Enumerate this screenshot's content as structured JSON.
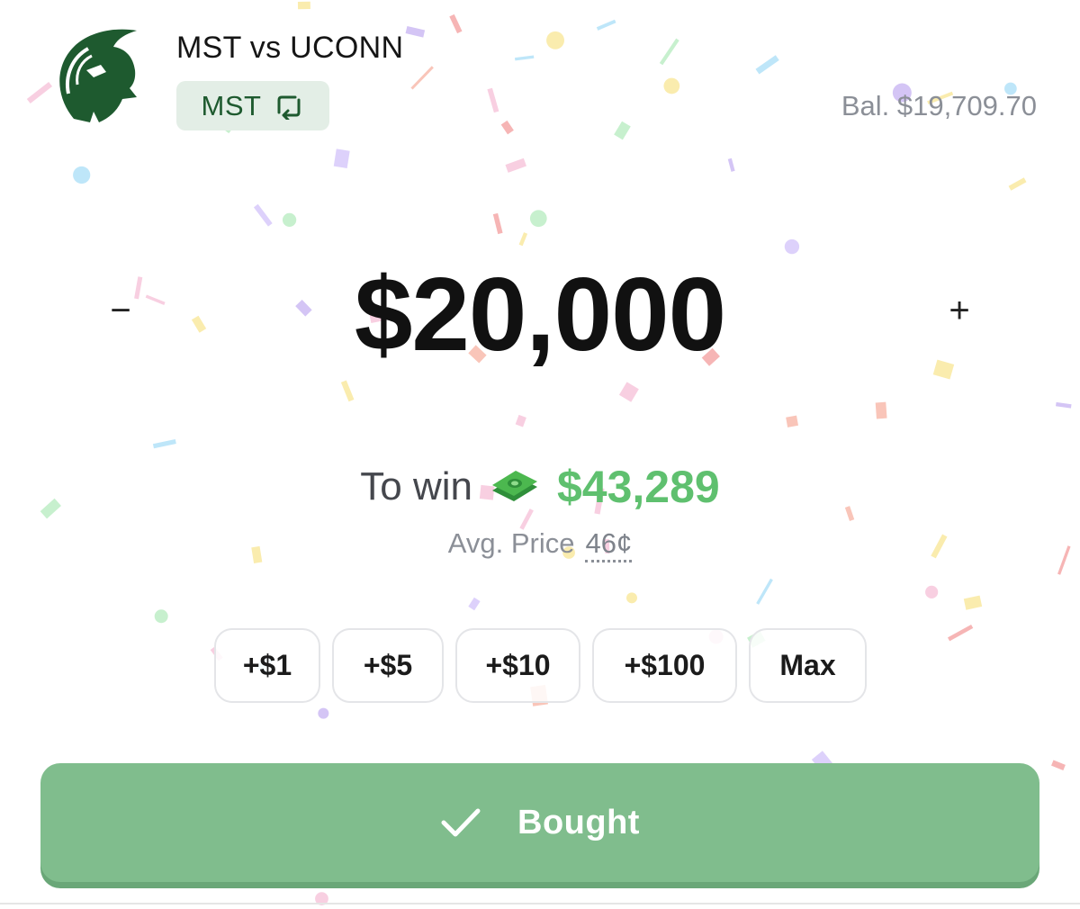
{
  "header": {
    "logo_icon": "spartan-helmet-icon",
    "matchup_title": "MST vs UCONN",
    "team_pill": {
      "label": "MST",
      "icon": "swap-icon"
    },
    "balance": "Bal. $19,709.70"
  },
  "wager": {
    "decrement_label": "−",
    "increment_label": "+",
    "amount": "$20,000"
  },
  "payout": {
    "to_win_label": "To win",
    "money_icon": "money-bill-icon",
    "to_win_value": "$43,289",
    "avg_price_label": "Avg. Price",
    "avg_price_value": "46¢"
  },
  "quick_add": [
    {
      "label": "+$1"
    },
    {
      "label": "+$5"
    },
    {
      "label": "+$10"
    },
    {
      "label": "+$100"
    },
    {
      "label": "Max"
    }
  ],
  "action": {
    "icon": "check-icon",
    "label": "Bought"
  },
  "colors": {
    "brand_green": "#1e5a2f",
    "win_green": "#5fc06f",
    "button_green": "#80bd8d",
    "muted_gray": "#8b8f97"
  }
}
